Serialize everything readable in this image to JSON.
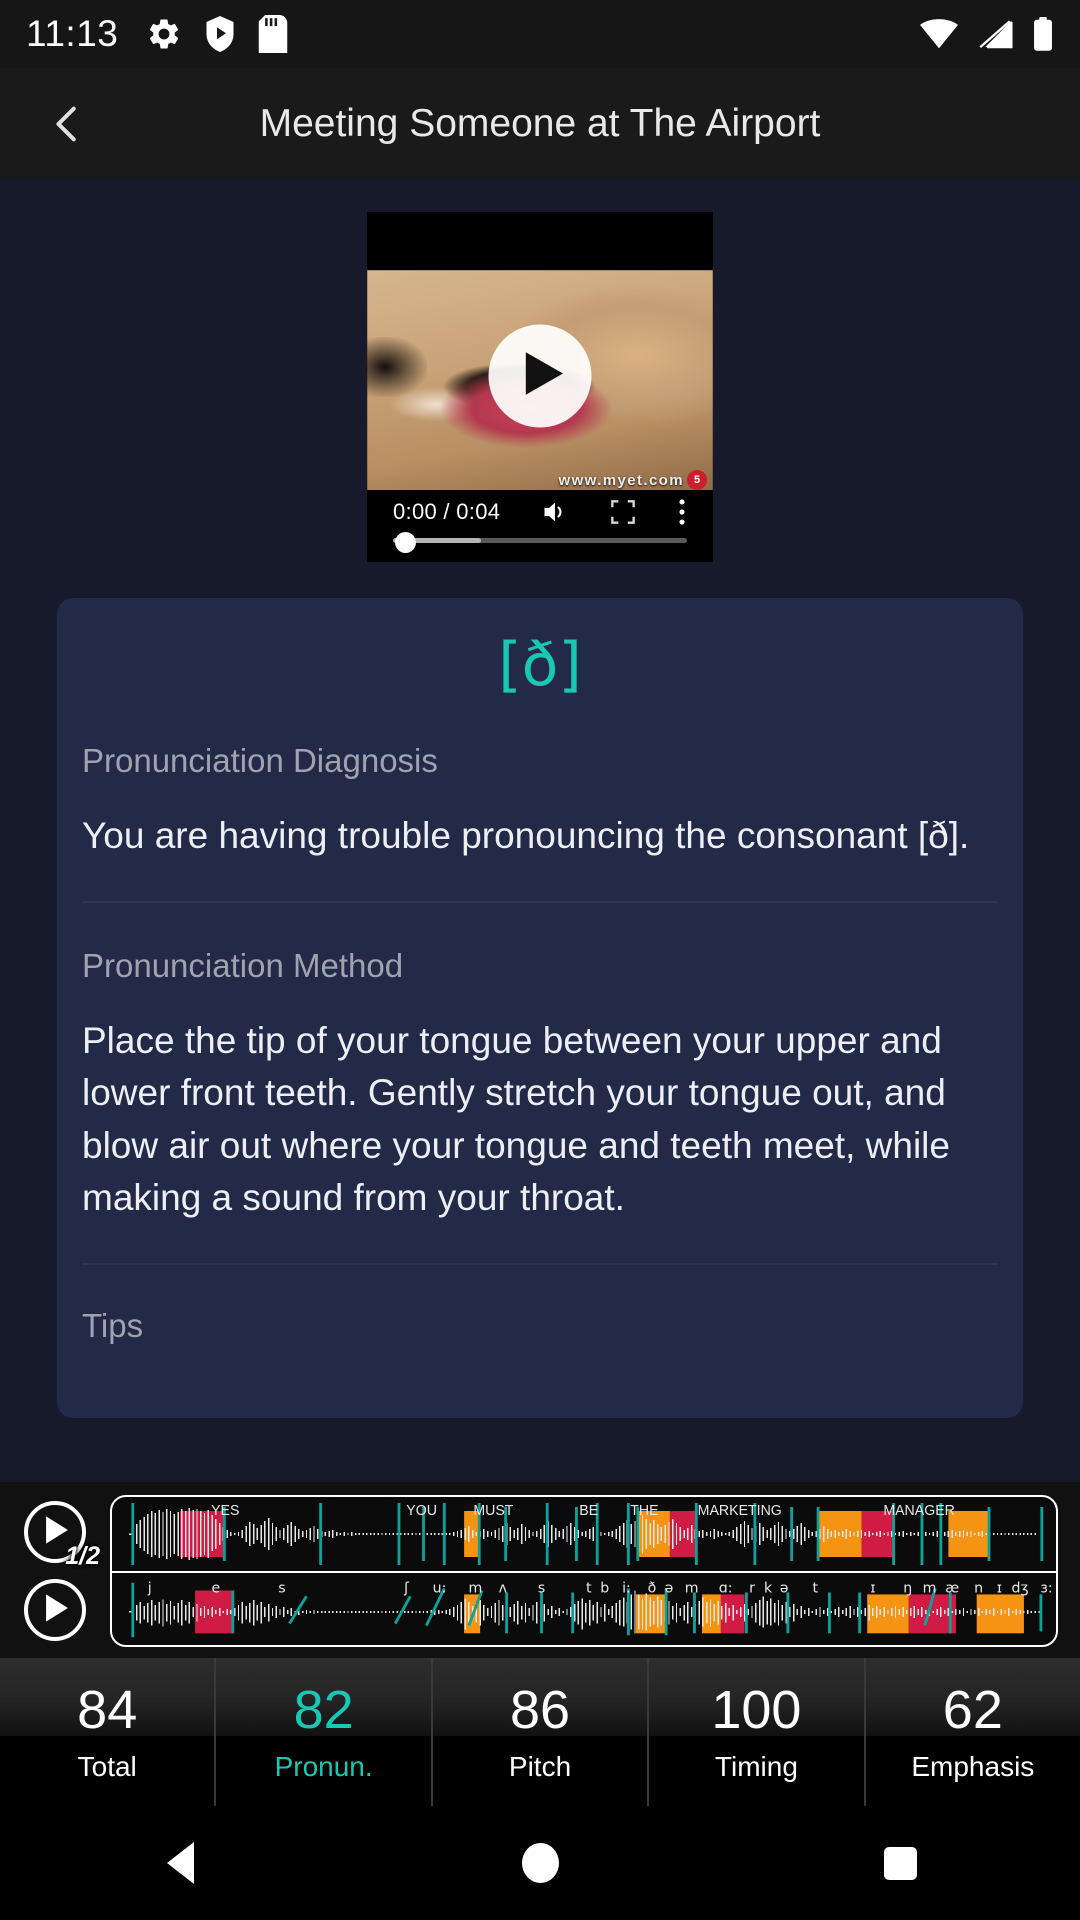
{
  "status_bar": {
    "time": "11:13",
    "left_icons": [
      "gear-icon",
      "play-shield-icon",
      "sd-card-icon"
    ],
    "right_icons": [
      "wifi-icon",
      "cellular-signal-icon",
      "battery-icon"
    ]
  },
  "app_bar": {
    "back_icon": "chevron-left-icon",
    "title": "Meeting Someone at The Airport"
  },
  "video": {
    "play_icon": "play-icon",
    "current_time": "0:00",
    "duration": "0:04",
    "time_display": "0:00 / 0:04",
    "volume_icon": "volume-icon",
    "fullscreen_icon": "fullscreen-icon",
    "more_icon": "more-vertical-icon",
    "watermark": "www.myet.com",
    "watermark_badge": "5",
    "progress_percent": 0
  },
  "card": {
    "ipa_symbol": "[ð]",
    "diagnosis_label": "Pronunciation Diagnosis",
    "diagnosis_text": "You are having trouble pronouncing the consonant [ð].",
    "method_label": "Pronunciation Method",
    "method_text": "Place the tip of your tongue between your upper and lower front teeth. Gently stretch your tongue out, and blow air out where your tongue and teeth meet, while making a sound from your throat.",
    "tips_label": "Tips"
  },
  "waveform": {
    "play_native_icon": "play-icon",
    "speed_badge": "1/2",
    "play_user_icon": "play-icon",
    "words": [
      "YES",
      "YOU",
      "MUST",
      "BE",
      "THE",
      "MARKETING",
      "MANAGER"
    ],
    "phonemes": [
      "j",
      "e",
      "s",
      "ʃ",
      "u:",
      "m",
      "ʌ",
      "s",
      "t",
      "b",
      "i:",
      "ð",
      "ə",
      "m",
      "ɑ:",
      "r",
      "k",
      "ə",
      "t",
      "ɪ",
      "ŋ",
      "m",
      "æ",
      "n",
      "ɪ",
      "dʒ",
      "ɜ:"
    ],
    "colors": {
      "highlight_red": "#D01C45",
      "highlight_orange": "#F59412",
      "boundary_teal": "#0FA09A",
      "waveform": "#E8E8E8"
    }
  },
  "scores": {
    "items": [
      {
        "value": "84",
        "label": "Total",
        "highlighted": false
      },
      {
        "value": "82",
        "label": "Pronun.",
        "highlighted": true
      },
      {
        "value": "86",
        "label": "Pitch",
        "highlighted": false
      },
      {
        "value": "100",
        "label": "Timing",
        "highlighted": false
      },
      {
        "value": "62",
        "label": "Emphasis",
        "highlighted": false
      }
    ]
  },
  "nav_bar": {
    "back_icon": "nav-back-triangle-icon",
    "home_icon": "nav-home-circle-icon",
    "recents_icon": "nav-recents-square-icon"
  },
  "theme": {
    "accent_teal": "#17C9B3",
    "page_bg": "#161A2B",
    "card_bg": "#222A47",
    "bar_bg": "#1A1A1A"
  }
}
